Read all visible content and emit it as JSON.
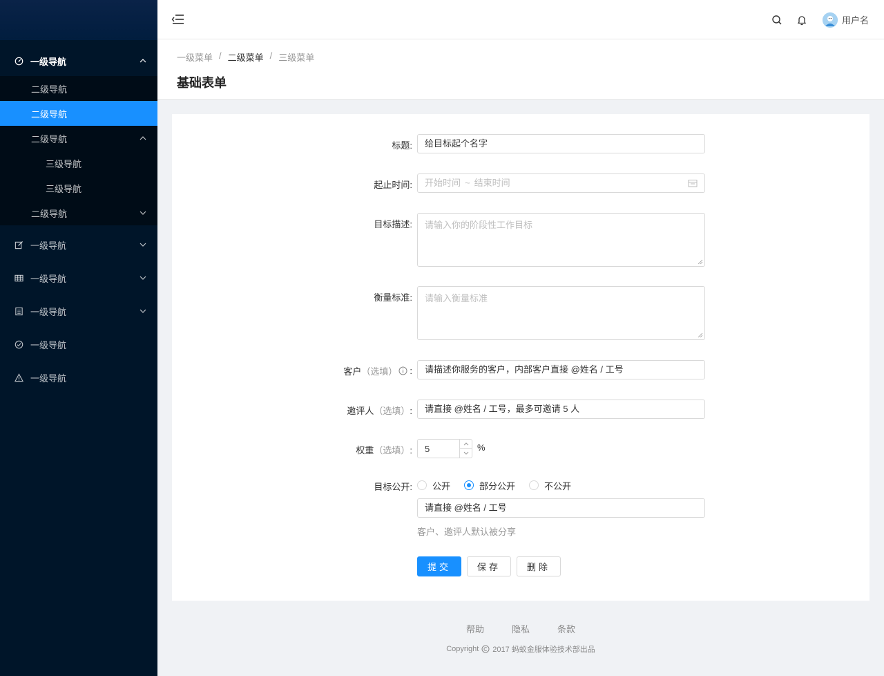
{
  "sidebar": {
    "open_l1": "一级导航",
    "sub": [
      {
        "label": "二级导航"
      },
      {
        "label": "二级导航"
      },
      {
        "label": "二级导航"
      },
      {
        "label": "二级导航"
      }
    ],
    "third": [
      {
        "label": "三级导航"
      },
      {
        "label": "三级导航"
      }
    ],
    "l1": [
      {
        "label": "一级导航",
        "icon": "edit-icon"
      },
      {
        "label": "一级导航",
        "icon": "table-icon"
      },
      {
        "label": "一级导航",
        "icon": "profile-icon"
      },
      {
        "label": "一级导航",
        "icon": "check-circle-icon"
      },
      {
        "label": "一级导航",
        "icon": "warning-icon"
      }
    ]
  },
  "header": {
    "username": "用户名"
  },
  "breadcrumb": {
    "items": [
      "一级菜单",
      "二级菜单",
      "三级菜单"
    ],
    "sep": "/"
  },
  "page": {
    "title": "基础表单"
  },
  "form": {
    "title_label": "标题:",
    "title_value": "给目标起个名字",
    "date_label": "起止时间:",
    "date_start_ph": "开始时间",
    "date_tilde": "~",
    "date_end_ph": "结束时间",
    "goal_label": "目标描述:",
    "goal_ph": "请输入你的阶段性工作目标",
    "standard_label": "衡量标准:",
    "standard_ph": "请输入衡量标准",
    "client_label": "客户",
    "client_opt": "（选填）",
    "client_colon": ":",
    "client_value": "请描述你服务的客户，内部客户直接 @姓名 / 工号",
    "invites_label": "邀评人",
    "invites_opt": "（选填）",
    "invites_colon": ":",
    "invites_value": "请直接 @姓名 / 工号，最多可邀请 5 人",
    "weight_label": "权重",
    "weight_opt": "（选填）",
    "weight_colon": ":",
    "weight_value": "5",
    "weight_unit": "%",
    "public_label": "目标公开:",
    "public_options": [
      "公开",
      "部分公开",
      "不公开"
    ],
    "public_selected": 1,
    "public_value": "请直接 @姓名 / 工号",
    "public_help": "客户、邀评人默认被分享",
    "submit": "提交",
    "save": "保存",
    "delete": "删除"
  },
  "footer": {
    "links": [
      "帮助",
      "隐私",
      "条款"
    ],
    "copyright_prefix": "Copyright",
    "copyright_text": "2017 蚂蚁金服体验技术部出品"
  },
  "colors": {
    "sidebar_bg": "#001529",
    "primary": "#1890ff"
  }
}
